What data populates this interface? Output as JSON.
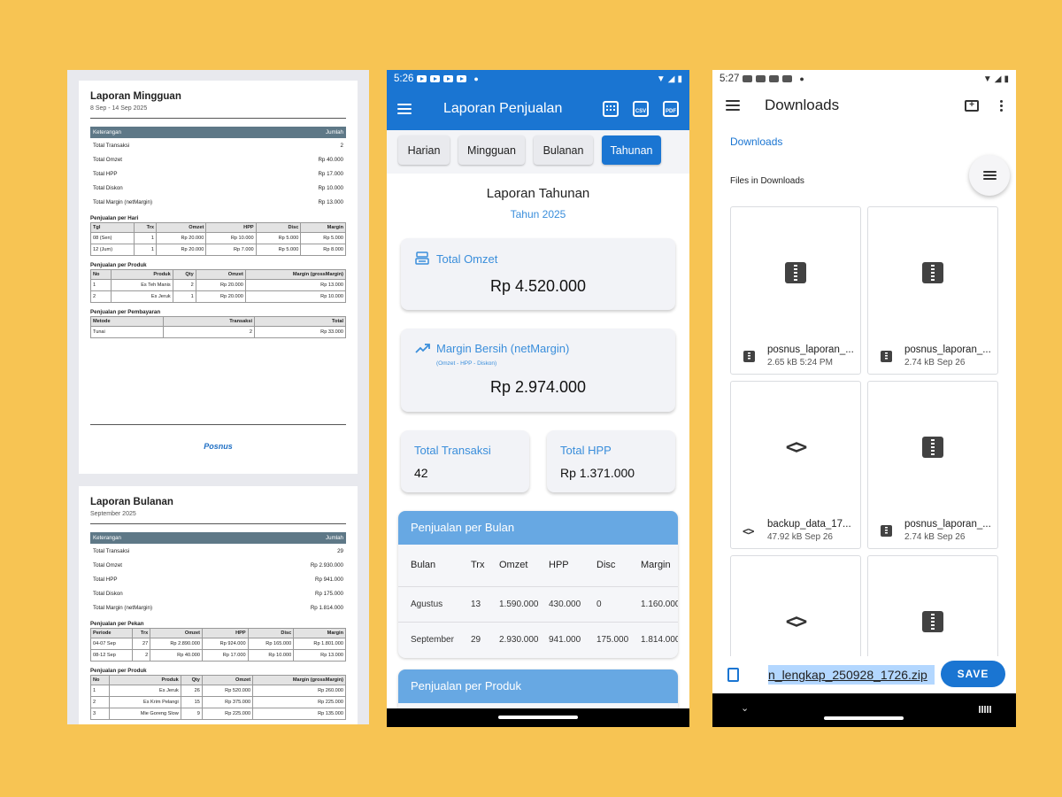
{
  "weekly_pdf": {
    "title": "Laporan Mingguan",
    "period": "8 Sep - 14 Sep 2025",
    "summary_header": [
      "Keterangan",
      "Jumlah"
    ],
    "summary": [
      {
        "label": "Total Transaksi",
        "value": "2"
      },
      {
        "label": "Total Omzet",
        "value": "Rp 40.000"
      },
      {
        "label": "Total HPP",
        "value": "Rp 17.000"
      },
      {
        "label": "Total Diskon",
        "value": "Rp 10.000"
      },
      {
        "label": "Total Margin (netMargin)",
        "value": "Rp 13.000"
      }
    ],
    "per_day": {
      "title": "Penjualan per Hari",
      "headers": [
        "Tgl",
        "Trx",
        "Omzet",
        "HPP",
        "Disc",
        "Margin"
      ],
      "rows": [
        [
          "08 (Sen)",
          "1",
          "Rp 20.000",
          "Rp 10.000",
          "Rp 5.000",
          "Rp 5.000"
        ],
        [
          "12 (Jum)",
          "1",
          "Rp 20.000",
          "Rp 7.000",
          "Rp 5.000",
          "Rp 8.000"
        ]
      ]
    },
    "per_product": {
      "title": "Penjualan per Produk",
      "headers": [
        "No",
        "Produk",
        "Qty",
        "Omzet",
        "Margin (grossMargin)"
      ],
      "rows": [
        [
          "1",
          "Es Teh Manis",
          "2",
          "Rp 20.000",
          "Rp 13.000"
        ],
        [
          "2",
          "Es Jeruk",
          "1",
          "Rp 20.000",
          "Rp 10.000"
        ]
      ]
    },
    "per_payment": {
      "title": "Penjualan per Pembayaran",
      "headers": [
        "Metode",
        "Transaksi",
        "Total"
      ],
      "rows": [
        [
          "Tunai",
          "2",
          "Rp 33.000"
        ]
      ]
    },
    "logo": "Posnus"
  },
  "monthly_pdf": {
    "title": "Laporan Bulanan",
    "period": "September 2025",
    "summary_header": [
      "Keterangan",
      "Jumlah"
    ],
    "summary": [
      {
        "label": "Total Transaksi",
        "value": "29"
      },
      {
        "label": "Total Omzet",
        "value": "Rp 2.930.000"
      },
      {
        "label": "Total HPP",
        "value": "Rp 941.000"
      },
      {
        "label": "Total Diskon",
        "value": "Rp 175.000"
      },
      {
        "label": "Total Margin (netMargin)",
        "value": "Rp 1.814.000"
      }
    ],
    "per_week": {
      "title": "Penjualan per Pekan",
      "headers": [
        "Periode",
        "Trx",
        "Omzet",
        "HPP",
        "Disc",
        "Margin"
      ],
      "rows": [
        [
          "04-07 Sep",
          "27",
          "Rp 2.890.000",
          "Rp 924.000",
          "Rp 165.000",
          "Rp 1.801.000"
        ],
        [
          "08-12 Sep",
          "2",
          "Rp 40.000",
          "Rp 17.000",
          "Rp 10.000",
          "Rp 13.000"
        ]
      ]
    },
    "per_product": {
      "title": "Penjualan per Produk",
      "headers": [
        "No",
        "Produk",
        "Qty",
        "Omzet",
        "Margin (grossMargin)"
      ],
      "rows": [
        [
          "1",
          "Es Jeruk",
          "26",
          "Rp 520.000",
          "Rp 260.000"
        ],
        [
          "2",
          "Es Krim Pelangi",
          "15",
          "Rp 375.000",
          "Rp 225.000"
        ],
        [
          "3",
          "Mie Goreng Slow",
          "9",
          "Rp 225.000",
          "Rp 135.000"
        ]
      ]
    }
  },
  "app": {
    "status_time": "5:26",
    "title": "Laporan Penjualan",
    "toolbar_icons": [
      "calendar-icon",
      "csv-icon",
      "pdf-icon"
    ],
    "csv_label": "CSV",
    "pdf_label": "PDF",
    "tabs": [
      {
        "label": "Harian",
        "active": false
      },
      {
        "label": "Mingguan",
        "active": false
      },
      {
        "label": "Bulanan",
        "active": false
      },
      {
        "label": "Tahunan",
        "active": true
      }
    ],
    "report_title": "Laporan Tahunan",
    "report_period": "Tahun 2025",
    "total_omzet": {
      "label": "Total Omzet",
      "value": "Rp 4.520.000"
    },
    "margin": {
      "label": "Margin Bersih (netMargin)",
      "note": "(Omzet - HPP - Diskon)",
      "value": "Rp 2.974.000"
    },
    "total_trx": {
      "label": "Total Transaksi",
      "value": "42"
    },
    "total_hpp": {
      "label": "Total HPP",
      "value": "Rp 1.371.000"
    },
    "per_month": {
      "title": "Penjualan per Bulan",
      "headers": [
        "Bulan",
        "Trx",
        "Omzet",
        "HPP",
        "Disc",
        "Margin"
      ],
      "rows": [
        [
          "Agustus",
          "13",
          "1.590.000",
          "430.000",
          "0",
          "1.160.000"
        ],
        [
          "September",
          "29",
          "2.930.000",
          "941.000",
          "175.000",
          "1.814.000"
        ]
      ]
    },
    "per_product_title": "Penjualan per Produk",
    "colors": {
      "primary": "#1A75D2",
      "accent": "#3A8EDB",
      "table_header": "#67A8E3"
    }
  },
  "picker": {
    "status_time": "5:27",
    "title": "Downloads",
    "breadcrumb": "Downloads",
    "files_label": "Files in Downloads",
    "files": [
      {
        "type": "zip",
        "name": "posnus_laporan_...",
        "meta": "2.65 kB 5:24 PM"
      },
      {
        "type": "zip",
        "name": "posnus_laporan_...",
        "meta": "2.74 kB Sep 26"
      },
      {
        "type": "code",
        "name": "backup_data_17...",
        "meta": "47.92 kB Sep 26"
      },
      {
        "type": "zip",
        "name": "posnus_laporan_...",
        "meta": "2.74 kB Sep 26"
      },
      {
        "type": "code",
        "name": "",
        "meta": ""
      },
      {
        "type": "zip",
        "name": "",
        "meta": ""
      }
    ],
    "filename": "n_lengkap_250928_1726.zip",
    "save_label": "SAVE"
  }
}
